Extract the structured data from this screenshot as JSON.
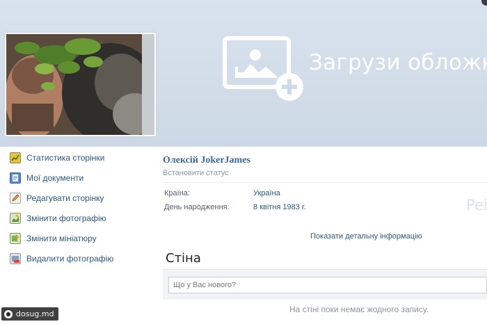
{
  "cover": {
    "upload_label": "Загрузи обложку",
    "upload_icon": "image-plus-icon"
  },
  "avatar": {
    "alt": "profile photo"
  },
  "sidebar": {
    "items": [
      {
        "label": "Статистика сторінки",
        "icon": "chart-icon"
      },
      {
        "label": "Мої документи",
        "icon": "document-icon"
      },
      {
        "label": "Редагувати сторінку",
        "icon": "edit-icon"
      },
      {
        "label": "Змінити фотографію",
        "icon": "photo-edit-icon"
      },
      {
        "label": "Змінити мініатюру",
        "icon": "thumbnail-edit-icon"
      },
      {
        "label": "Видалити фотографію",
        "icon": "photo-delete-icon"
      }
    ]
  },
  "profile": {
    "name": "Олексій JokerJames",
    "status_placeholder": "Встановити статус",
    "info": [
      {
        "label": "Країна:",
        "value": "Україна"
      },
      {
        "label": "День народження:",
        "value": "8 квітня 1983 г."
      }
    ],
    "faded_text": "Pei",
    "details_link": "Показати детальну інформацію"
  },
  "wall": {
    "title": "Стіна",
    "input_placeholder": "Що у Вас нового?",
    "empty_text": "На стіні поки немає жодного запису."
  },
  "watermark": {
    "text": "dosug.md"
  },
  "colors": {
    "cover_bg": "#d3dde9",
    "link": "#2b587a",
    "name": "#3b6a9a"
  }
}
